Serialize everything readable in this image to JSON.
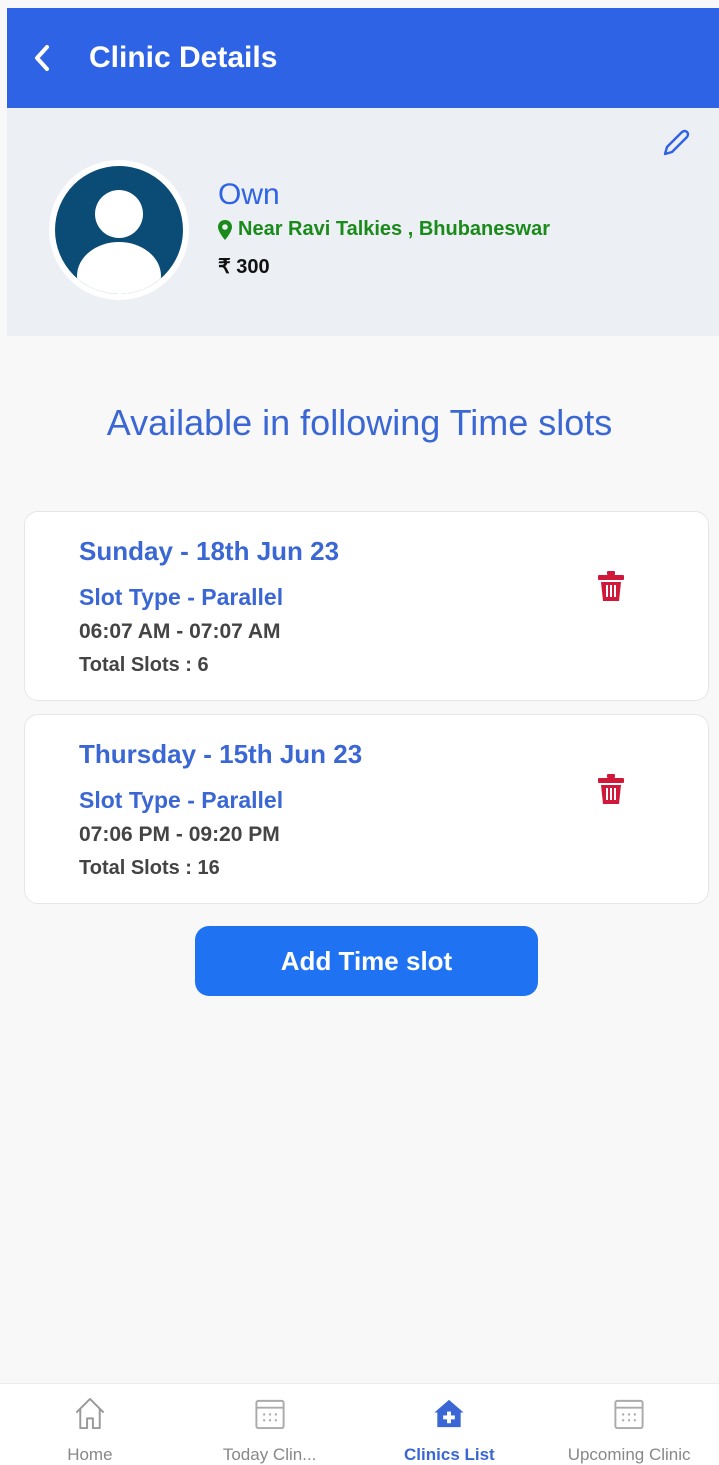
{
  "header": {
    "title": "Clinic Details"
  },
  "clinic": {
    "name": "Own",
    "location": "Near Ravi Talkies , Bhubaneswar",
    "fee": "₹ 300"
  },
  "section_title": "Available in following Time slots",
  "slots": [
    {
      "date": "Sunday - 18th Jun 23",
      "type": "Slot Type - Parallel",
      "time": "06:07 AM - 07:07 AM",
      "total": "Total Slots : 6"
    },
    {
      "date": "Thursday - 15th Jun 23",
      "type": "Slot Type - Parallel",
      "time": "07:06 PM - 09:20 PM",
      "total": "Total Slots : 16"
    }
  ],
  "add_button": "Add Time slot",
  "nav": [
    {
      "label": "Home",
      "icon": "home-icon"
    },
    {
      "label": "Today Clin...",
      "icon": "calendar-icon"
    },
    {
      "label": "Clinics List",
      "icon": "clinic-home-icon",
      "active": true
    },
    {
      "label": "Upcoming Clinic",
      "icon": "calendar-icon"
    }
  ],
  "colors": {
    "primary": "#2f63e6",
    "delete": "#d0193a",
    "location": "#1a8a1a",
    "button": "#1f73f2"
  }
}
